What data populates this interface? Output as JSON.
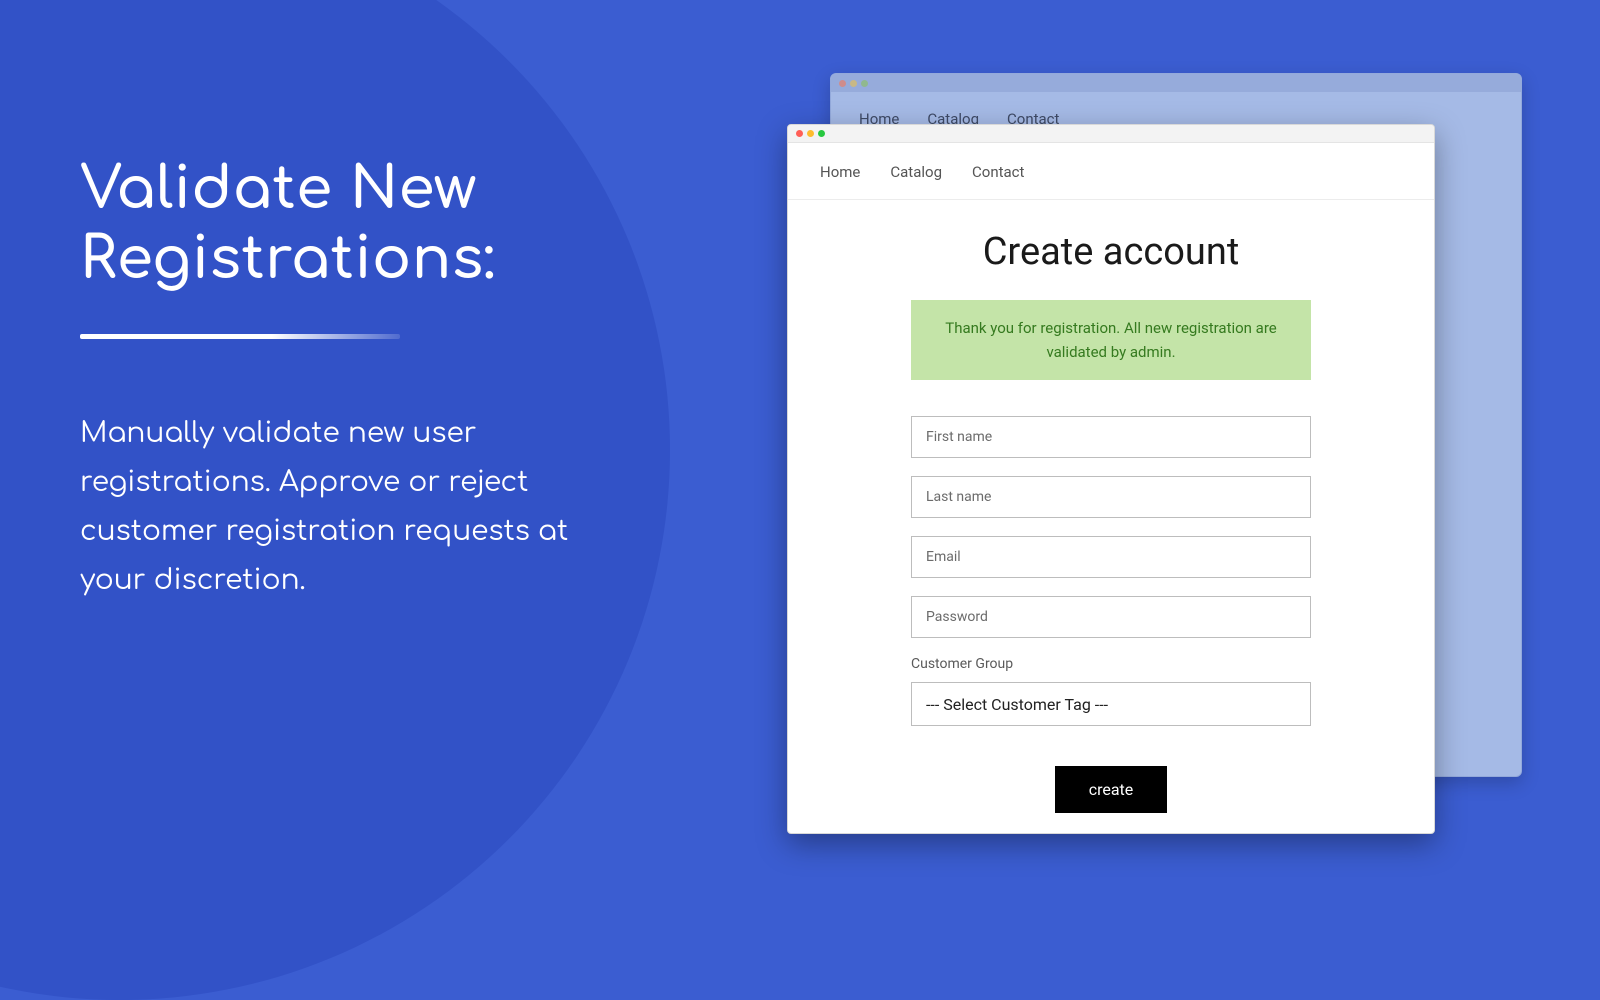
{
  "marketing": {
    "headline_line1": "Validate New",
    "headline_line2": "Registrations:",
    "description": "Manually validate new user registrations. Approve or reject customer registration requests at your discretion."
  },
  "back_window": {
    "nav": {
      "home": "Home",
      "catalog": "Catalog",
      "contact": "Contact"
    }
  },
  "front_window": {
    "nav": {
      "home": "Home",
      "catalog": "Catalog",
      "contact": "Contact"
    },
    "form": {
      "title": "Create account",
      "success_message": "Thank you for registration. All new registration are validated by admin.",
      "first_name_placeholder": "First name",
      "last_name_placeholder": "Last name",
      "email_placeholder": "Email",
      "password_placeholder": "Password",
      "customer_group_label": "Customer Group",
      "customer_group_selected": " --- Select Customer Tag ---",
      "submit_label": "create"
    }
  }
}
